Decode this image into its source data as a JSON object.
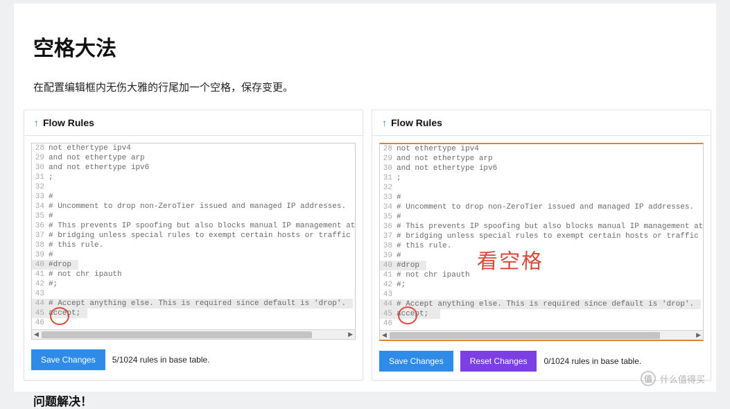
{
  "heading": "空格大法",
  "subline": "在配置编辑框内无伤大雅的行尾加一个空格，保存变更。",
  "solved": "问题解决！",
  "panel_title": "Flow Rules",
  "code": {
    "28": "not ethertype ipv4",
    "29": "and not ethertype arp",
    "30": "and not ethertype ipv6",
    "31": ";",
    "32": "",
    "33": "#",
    "34": "# Uncomment to drop non-ZeroTier issued and managed IP addresses.",
    "35": "#",
    "36": "# This prevents IP spoofing but also blocks manual IP management at the OS le",
    "37": "# bridging unless special rules to exempt certain hosts or traffic are added",
    "38": "# this rule.",
    "39": "#",
    "40": "#drop",
    "41": "# not chr ipauth",
    "42": "#;",
    "43": "",
    "44": "# Accept anything else. This is required since default is 'drop'.",
    "45": "accept;",
    "46": ""
  },
  "buttons": {
    "save": "Save Changes",
    "reset": "Reset Changes"
  },
  "ruletext_left": "5/1024 rules in base table.",
  "ruletext_right": "0/1024 rules in base table.",
  "annotation": "看空格",
  "watermark": {
    "icon": "值",
    "text": "什么值得买"
  }
}
